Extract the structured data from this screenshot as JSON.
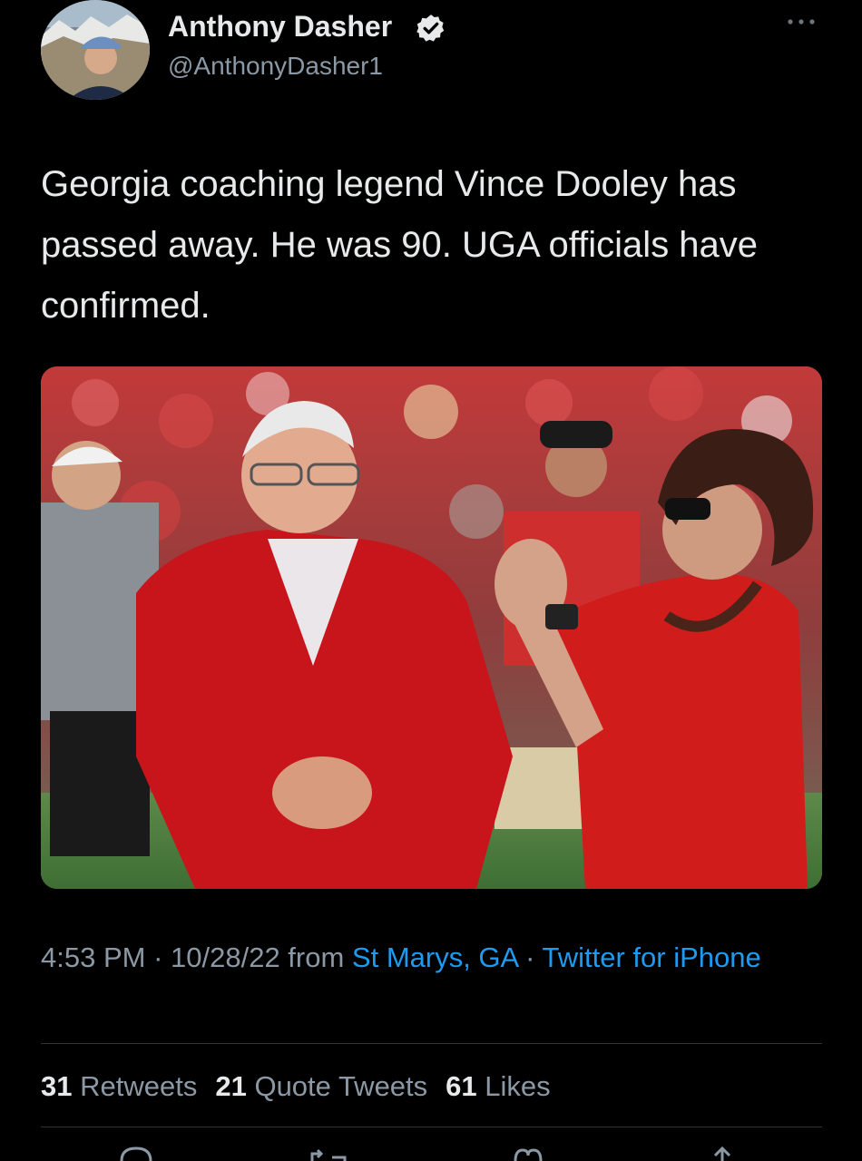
{
  "author": {
    "display_name": "Anthony Dasher",
    "handle": "@AnthonyDasher1",
    "verified_icon": "verified-badge-icon"
  },
  "tweet": {
    "text": "Georgia coaching legend Vince Dooley has passed away. He was 90. UGA officials have confirmed."
  },
  "meta": {
    "time": "4:53 PM",
    "sep1": " · ",
    "date": "10/28/22",
    "from": " from ",
    "location": "St Marys, GA",
    "sep2": " · ",
    "client": "Twitter for iPhone"
  },
  "stats": {
    "retweets_count": "31",
    "retweets_label": "Retweets",
    "quotes_count": "21",
    "quotes_label": "Quote Tweets",
    "likes_count": "61",
    "likes_label": "Likes"
  },
  "colors": {
    "background": "#000000",
    "text": "#e7e9ea",
    "secondary": "#8b98a5",
    "link": "#1d9bf0"
  },
  "icons": [
    "more-options-icon",
    "reply-icon",
    "retweet-icon",
    "like-icon",
    "share-icon"
  ]
}
